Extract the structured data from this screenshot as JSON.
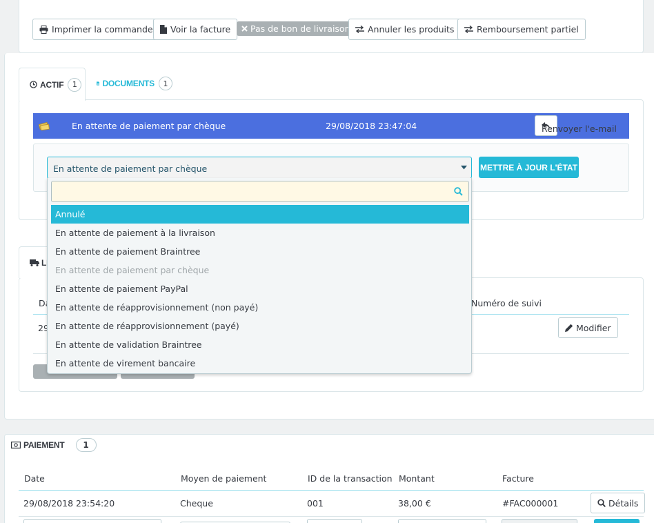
{
  "toolbar": {
    "print_label": "Imprimer la commande",
    "invoice_label": "Voir la facture",
    "no_delivery_label": "Pas de bon de livraison",
    "cancel_products_label": "Annuler les produits",
    "partial_refund_label": "Remboursement partiel"
  },
  "tabs": {
    "active": {
      "label": "ACTIF",
      "count": "1"
    },
    "documents": {
      "label": "DOCUMENTS",
      "count": "1"
    }
  },
  "history": {
    "status": "En attente de paiement par chèque",
    "date": "29/08/2018 23:47:04",
    "resend_label": "Renvoyer l'e-mail"
  },
  "state_form": {
    "selected": "En attente de paiement par chèque",
    "update_label": "METTRE À JOUR L'ÉTAT",
    "options": [
      {
        "label": "Annulé",
        "state": "active"
      },
      {
        "label": "En attente de paiement à la livraison",
        "state": "normal"
      },
      {
        "label": "En attente de paiement Braintree",
        "state": "normal"
      },
      {
        "label": "En attente de paiement par chèque",
        "state": "disabled"
      },
      {
        "label": "En attente de paiement PayPal",
        "state": "normal"
      },
      {
        "label": "En attente de réapprovisionnement (non payé)",
        "state": "normal"
      },
      {
        "label": "En attente de réapprovisionnement (payé)",
        "state": "normal"
      },
      {
        "label": "En attente de validation Braintree",
        "state": "normal"
      },
      {
        "label": "En attente de virement bancaire",
        "state": "normal"
      }
    ]
  },
  "shipping": {
    "tab_partial": "LI",
    "col_partial": "Da",
    "cell_partial": "29",
    "tracking_header": "Numéro de suivi",
    "modify_label": "Modifier"
  },
  "payment": {
    "title": "PAIEMENT",
    "count": "1",
    "headers": [
      "Date",
      "Moyen de paiement",
      "ID de la transaction",
      "Montant",
      "Facture"
    ],
    "row": {
      "date": "29/08/2018 23:54:20",
      "method": "Cheque",
      "transaction": "001",
      "amount": "38,00 €",
      "invoice": "#FAC000001"
    },
    "details_label": "Détails"
  },
  "colors": {
    "accent": "#25b9d7",
    "history_bar": "#4b6fdf",
    "disabled_badge": "#a9b0b3"
  }
}
